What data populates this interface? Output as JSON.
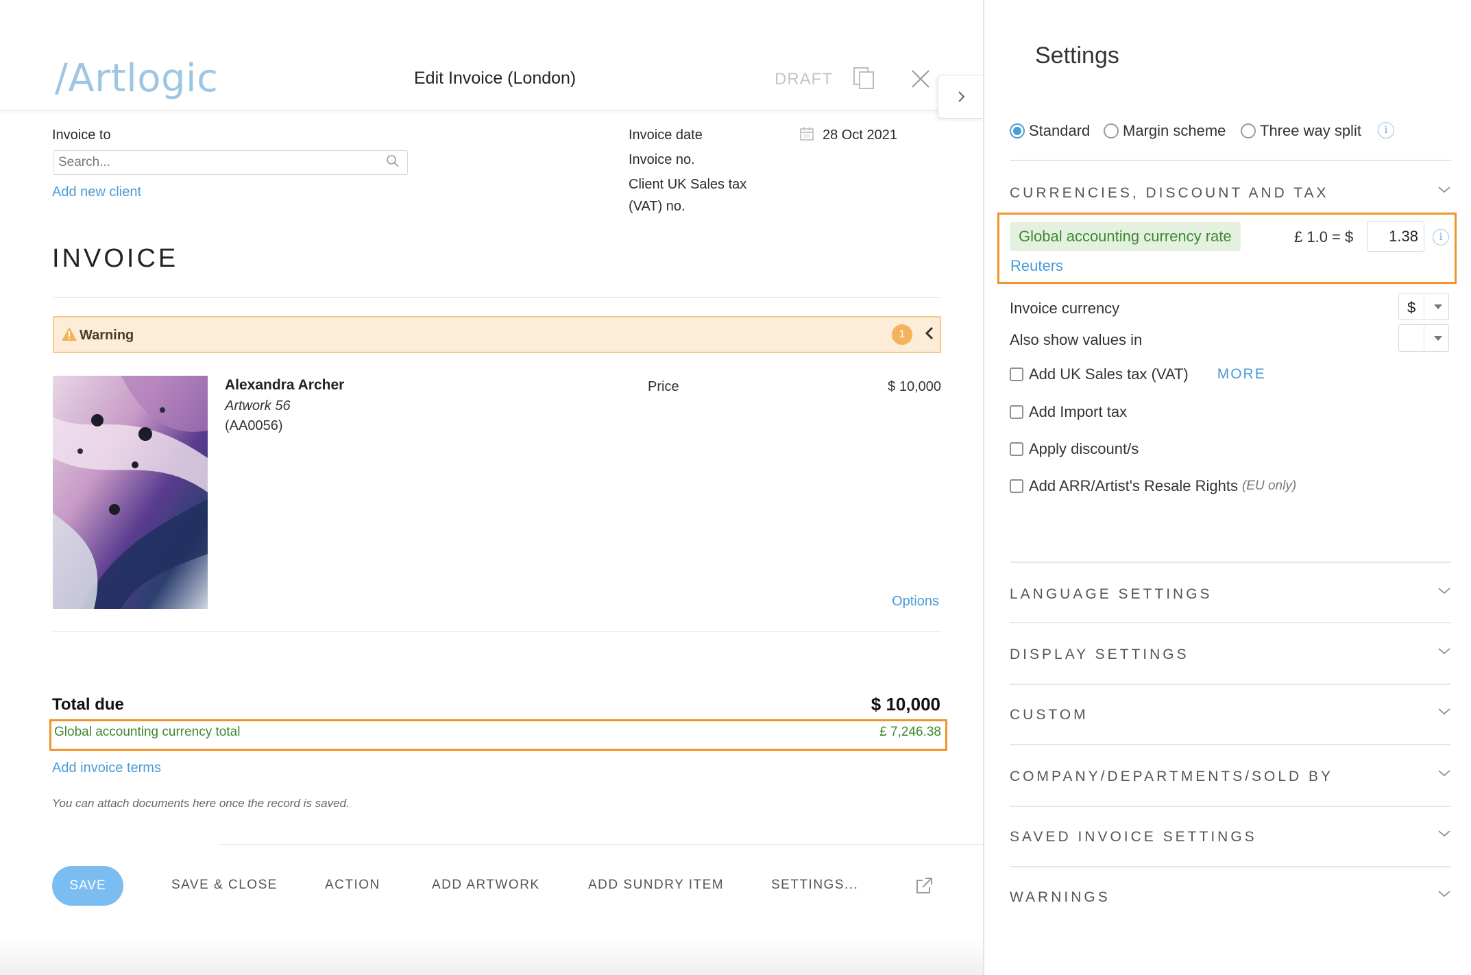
{
  "header": {
    "logo": "/Artlogic",
    "title": "Edit Invoice (London)",
    "status": "DRAFT"
  },
  "invoice_to": {
    "label": "Invoice to",
    "search_placeholder": "Search...",
    "add_client": "Add new client"
  },
  "meta": {
    "date_label": "Invoice date",
    "date_value": "28 Oct 2021",
    "number_label": "Invoice no.",
    "vat_label_line1": "Client UK Sales tax",
    "vat_label_line2": "(VAT) no."
  },
  "heading": "INVOICE",
  "warning": {
    "label": "Warning",
    "count": "1"
  },
  "item": {
    "artist": "Alexandra Archer",
    "artwork_title": "Artwork 56",
    "code": "(AA0056)",
    "price_label": "Price",
    "price_value": "$ 10,000",
    "options": "Options"
  },
  "totals": {
    "total_label": "Total due",
    "total_value": "$ 10,000",
    "global_label": "Global accounting currency total",
    "global_value": "£ 7,246.38"
  },
  "terms_link": "Add invoice terms",
  "attach_note": "You can attach documents here once the record is saved.",
  "footer": {
    "save": "SAVE",
    "save_close": "SAVE & CLOSE",
    "action": "ACTION",
    "add_artwork": "ADD ARTWORK",
    "add_sundry": "ADD SUNDRY ITEM",
    "settings": "SETTINGS..."
  },
  "settings": {
    "title": "Settings",
    "schemes": [
      {
        "label": "Standard",
        "selected": true
      },
      {
        "label": "Margin scheme",
        "selected": false
      },
      {
        "label": "Three way split",
        "selected": false
      }
    ],
    "currencies_header": "CURRENCIES, DISCOUNT AND TAX",
    "rate_label": "Global accounting currency rate",
    "rate_from": "£ 1.0  =  $",
    "rate_value": "1.38",
    "rate_source": "Reuters",
    "invoice_currency_label": "Invoice currency",
    "invoice_currency_value": "$",
    "also_show_label": "Also show values in",
    "also_show_value": "",
    "checkboxes": [
      {
        "label": "Add UK Sales tax (VAT)",
        "checked": false
      },
      {
        "label": "Add Import tax",
        "checked": false
      },
      {
        "label": "Apply discount/s",
        "checked": false
      },
      {
        "label": "Add ARR/Artist's Resale Rights",
        "checked": false
      }
    ],
    "more": "MORE",
    "eu_only": "(EU only)",
    "sections": [
      "LANGUAGE SETTINGS",
      "DISPLAY SETTINGS",
      "CUSTOM",
      "COMPANY/DEPARTMENTS/SOLD BY",
      "SAVED INVOICE SETTINGS",
      "WARNINGS"
    ]
  },
  "colors": {
    "accent_blue": "#4a9bd6",
    "highlight_orange": "#f0932b",
    "green_text": "#3b8a2e",
    "warning_bg": "#fdecd8"
  }
}
